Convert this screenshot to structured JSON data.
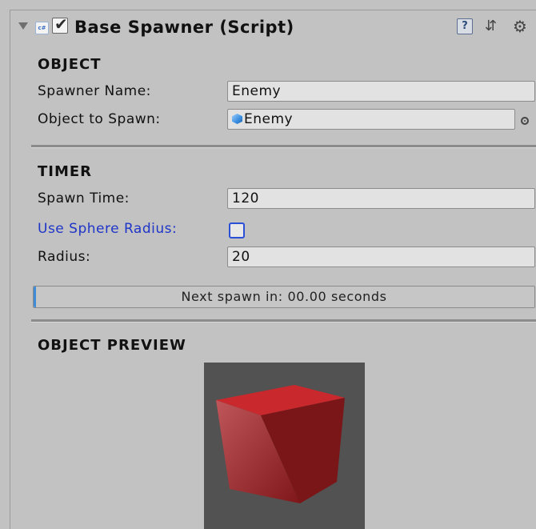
{
  "component": {
    "title": "Base Spawner (Script)",
    "script_icon_text": "c#",
    "enabled": true,
    "icons": [
      "help-icon",
      "preset-icon",
      "gear-icon"
    ]
  },
  "sections": {
    "object": {
      "heading": "OBJECT",
      "spawner_name_label": "Spawner Name:",
      "spawner_name_value": "Enemy",
      "object_to_spawn_label": "Object to Spawn:",
      "object_to_spawn_value": "Enemy"
    },
    "timer": {
      "heading": "TIMER",
      "spawn_time_label": "Spawn Time:",
      "spawn_time_value": "120",
      "use_sphere_radius_label": "Use Sphere Radius:",
      "use_sphere_radius_checked": false,
      "radius_label": "Radius:",
      "radius_value": "20",
      "progress_text": "Next spawn in: 00.00 seconds",
      "progress_fraction": 0.0
    },
    "preview": {
      "heading": "OBJECT PREVIEW"
    }
  },
  "colors": {
    "panel_bg": "#c2c2c2",
    "label_highlight": "#1f35c8",
    "cube_front": "#b01f24",
    "cube_top": "#d02a2e",
    "cube_side": "#7c1518",
    "preview_bg": "#525252"
  }
}
